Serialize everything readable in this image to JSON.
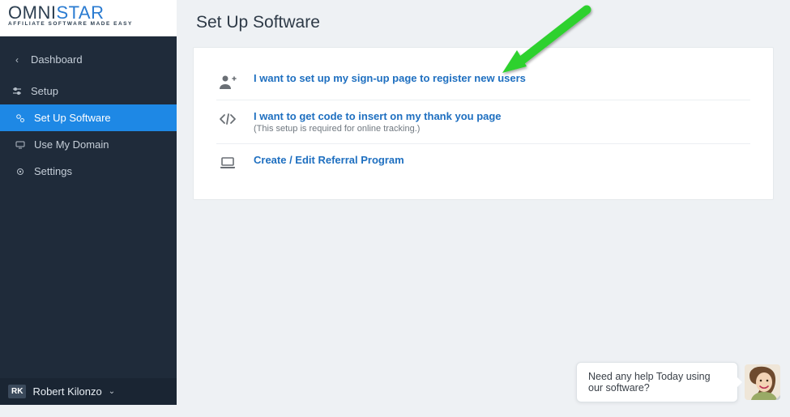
{
  "brand": {
    "name_part1": "OMNI",
    "name_part2": "STAR",
    "tagline": "AFFILIATE SOFTWARE MADE EASY"
  },
  "sidebar": {
    "back_label": "Dashboard",
    "parent_label": "Setup",
    "items": [
      {
        "label": "Set Up Software"
      },
      {
        "label": "Use My Domain"
      },
      {
        "label": "Settings"
      }
    ],
    "user": {
      "initials": "RK",
      "name": "Robert Kilonzo"
    }
  },
  "page": {
    "title": "Set Up Software",
    "options": [
      {
        "link": "I want to set up my sign-up page to register new users",
        "sub": ""
      },
      {
        "link": "I want to get code to insert on my thank you page",
        "sub": "(This setup is required for online tracking.)"
      },
      {
        "link": "Create / Edit Referral Program",
        "sub": ""
      }
    ]
  },
  "chat": {
    "message": "Need any help Today using our software?"
  }
}
